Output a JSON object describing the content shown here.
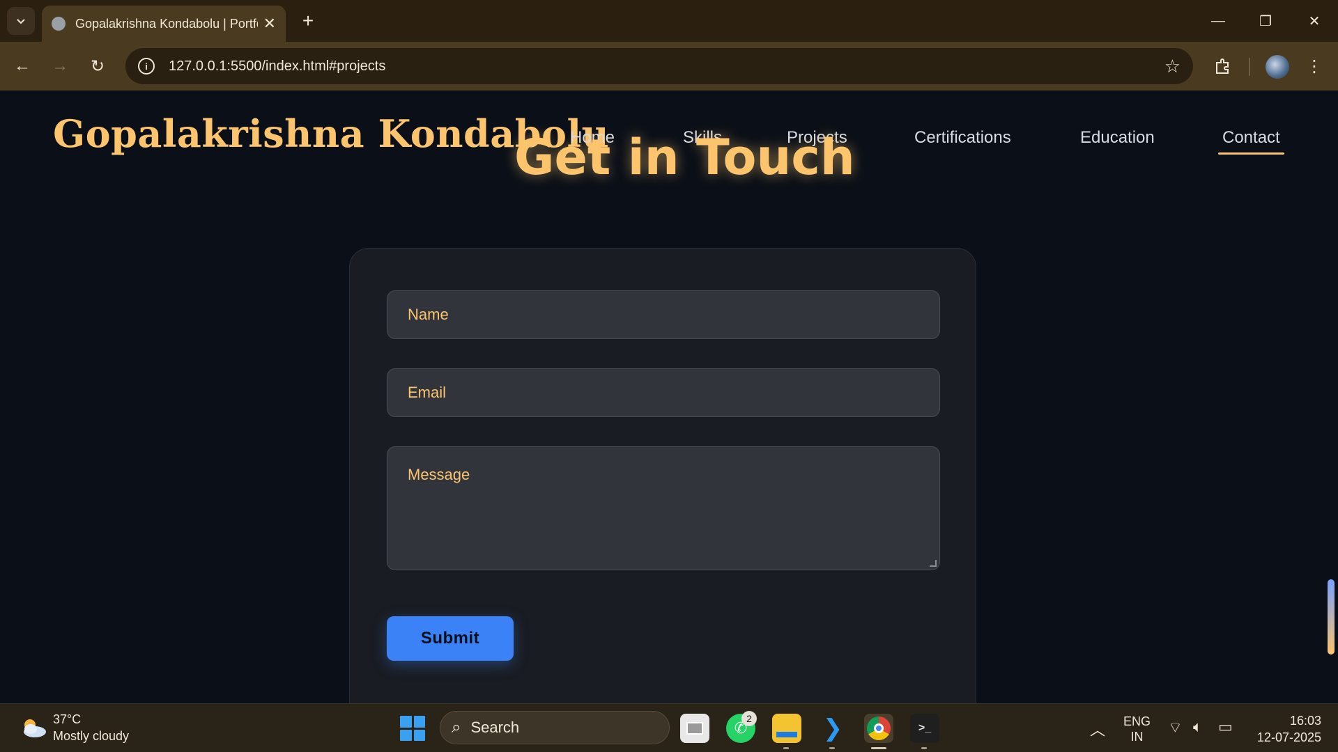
{
  "browser": {
    "tab_title": "Gopalakrishna Kondabolu | Portfolio",
    "url": "127.0.0.1:5500/index.html#projects"
  },
  "site": {
    "brand": "Gopalakrishna Kondabolu",
    "nav": [
      "Home",
      "Skills",
      "Projects",
      "Certifications",
      "Education",
      "Contact"
    ],
    "active_nav": "Contact",
    "heading": "Get in Touch",
    "form": {
      "name_placeholder": "Name",
      "email_placeholder": "Email",
      "message_placeholder": "Message",
      "submit_label": "Submit"
    }
  },
  "taskbar": {
    "weather_temp": "37°C",
    "weather_desc": "Mostly cloudy",
    "search_label": "Search",
    "whatsapp_badge": "2",
    "lang_line1": "ENG",
    "lang_line2": "IN",
    "time": "16:03",
    "date": "12-07-2025"
  },
  "colors": {
    "accent_gold": "#fcc46d",
    "submit_blue": "#3b82f6",
    "page_bg": "#0b1018"
  }
}
